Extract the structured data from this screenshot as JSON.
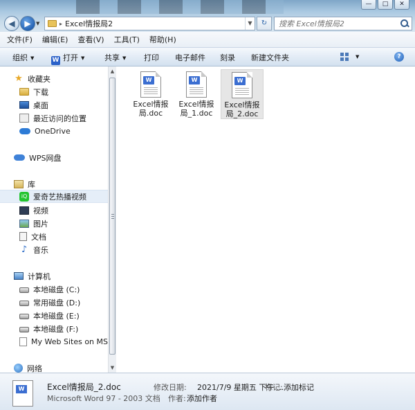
{
  "window": {
    "min_glyph": "—",
    "max_glyph": "□",
    "close_glyph": "✕"
  },
  "address": {
    "path": "Excel情报局2",
    "sep": "▸"
  },
  "search": {
    "placeholder": "搜索 Excel情报局2"
  },
  "menu": [
    "文件(F)",
    "编辑(E)",
    "查看(V)",
    "工具(T)",
    "帮助(H)"
  ],
  "toolbar": {
    "organize": "组织",
    "open": "打开",
    "share": "共享",
    "print": "打印",
    "email": "电子邮件",
    "burn": "刻录",
    "new_folder": "新建文件夹",
    "help_glyph": "?"
  },
  "nav": {
    "favorites": "收藏夹",
    "downloads": "下载",
    "desktop": "桌面",
    "recent": "最近访问的位置",
    "onedrive": "OneDrive",
    "wps": "WPS网盘",
    "library": "库",
    "iqiyi": "爱奇艺热播视频",
    "videos": "视频",
    "pictures": "图片",
    "documents": "文档",
    "music": "音乐",
    "computer": "计算机",
    "drive_c": "本地磁盘 (C:)",
    "drive_d": "常用磁盘 (D:)",
    "drive_e": "本地磁盘 (E:)",
    "drive_f": "本地磁盘 (F:)",
    "mywebsites": "My Web Sites on MSN",
    "network": "网络"
  },
  "files": [
    {
      "line1": "Excel情报",
      "line2": "局.doc",
      "selected": false
    },
    {
      "line1": "Excel情报",
      "line2": "局_1.doc",
      "selected": false
    },
    {
      "line1": "Excel情报",
      "line2": "局_2.doc",
      "selected": true
    }
  ],
  "details": {
    "name": "Excel情报局_2.doc",
    "type": "Microsoft Word 97 - 2003 文档",
    "modified_label": "修改日期:",
    "modified_value": "2021/7/9 星期五 下午 ...",
    "tags_label": "标记:",
    "tags_value": "添加标记",
    "author_label": "作者:",
    "author_value": "添加作者"
  }
}
